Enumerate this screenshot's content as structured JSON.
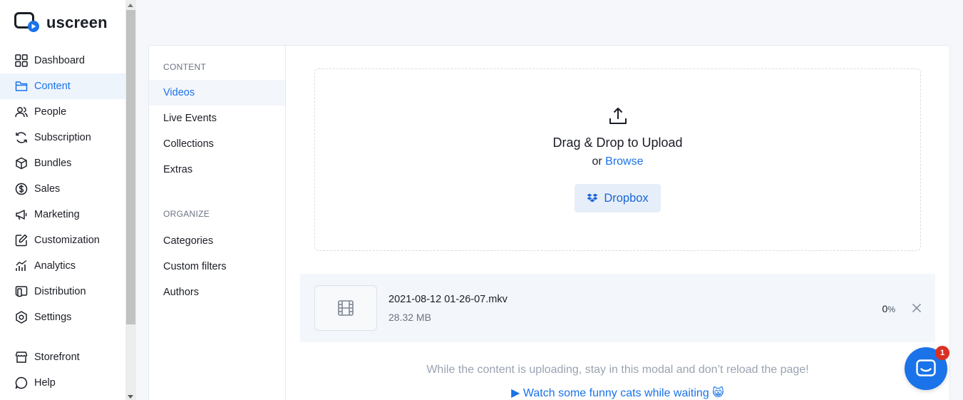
{
  "brand": {
    "name": "uscreen",
    "accent": "#1a73e8"
  },
  "sidebar": {
    "items": [
      {
        "label": "Dashboard",
        "icon": "dashboard-icon"
      },
      {
        "label": "Content",
        "icon": "folder-icon",
        "active": true
      },
      {
        "label": "People",
        "icon": "people-icon"
      },
      {
        "label": "Subscription",
        "icon": "subscription-icon"
      },
      {
        "label": "Bundles",
        "icon": "box-icon"
      },
      {
        "label": "Sales",
        "icon": "dollar-icon"
      },
      {
        "label": "Marketing",
        "icon": "megaphone-icon"
      },
      {
        "label": "Customization",
        "icon": "edit-icon"
      },
      {
        "label": "Analytics",
        "icon": "analytics-icon"
      },
      {
        "label": "Distribution",
        "icon": "devices-icon"
      },
      {
        "label": "Settings",
        "icon": "settings-icon"
      }
    ],
    "bottom_items": [
      {
        "label": "Storefront",
        "icon": "storefront-icon"
      },
      {
        "label": "Help",
        "icon": "help-icon"
      }
    ]
  },
  "subnav": {
    "content_heading": "CONTENT",
    "content_items": [
      "Videos",
      "Live Events",
      "Collections",
      "Extras"
    ],
    "organize_heading": "ORGANIZE",
    "organize_items": [
      "Categories",
      "Custom filters",
      "Authors"
    ]
  },
  "upload": {
    "title": "Drag & Drop to Upload",
    "or_text": "or",
    "browse_label": "Browse",
    "dropbox_label": "Dropbox"
  },
  "file": {
    "name": "2021-08-12 01-26-07.mkv",
    "size": "28.32 MB",
    "progress_value": "0",
    "progress_unit": "%"
  },
  "notice": "While the content is uploading, stay in this modal and don’t reload the page!",
  "cats_link": "▶ Watch some funny cats while waiting 😸",
  "chat": {
    "badge_count": "1"
  }
}
